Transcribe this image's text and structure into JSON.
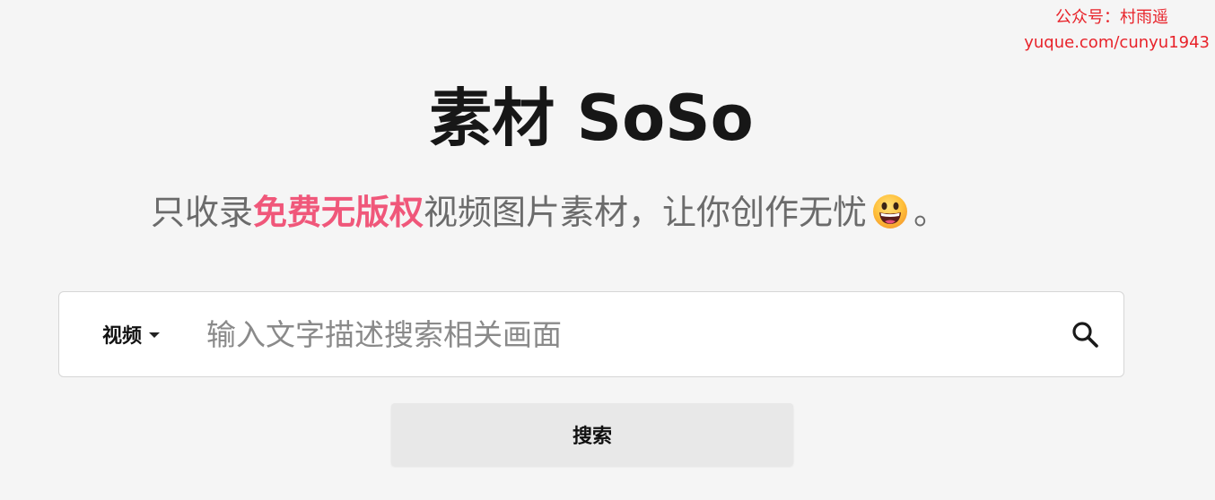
{
  "watermark": {
    "line1": "公众号：村雨遥",
    "line2": "yuque.com/cunyu1943"
  },
  "hero": {
    "title": "素材 SoSo"
  },
  "tagline": {
    "prefix": "只收录",
    "highlight": "免费无版权",
    "suffix": "视频图片素材，让你创作无忧",
    "emoji_icon": "grinning-face-emoji",
    "end": "。"
  },
  "search": {
    "type_selected": "视频",
    "placeholder": "输入文字描述搜索相关画面",
    "value": "",
    "search_icon": "magnifier-icon",
    "button_label": "搜索"
  },
  "colors": {
    "highlight": "#f0577a",
    "watermark": "#e8232a",
    "background": "#f5f5f5"
  }
}
